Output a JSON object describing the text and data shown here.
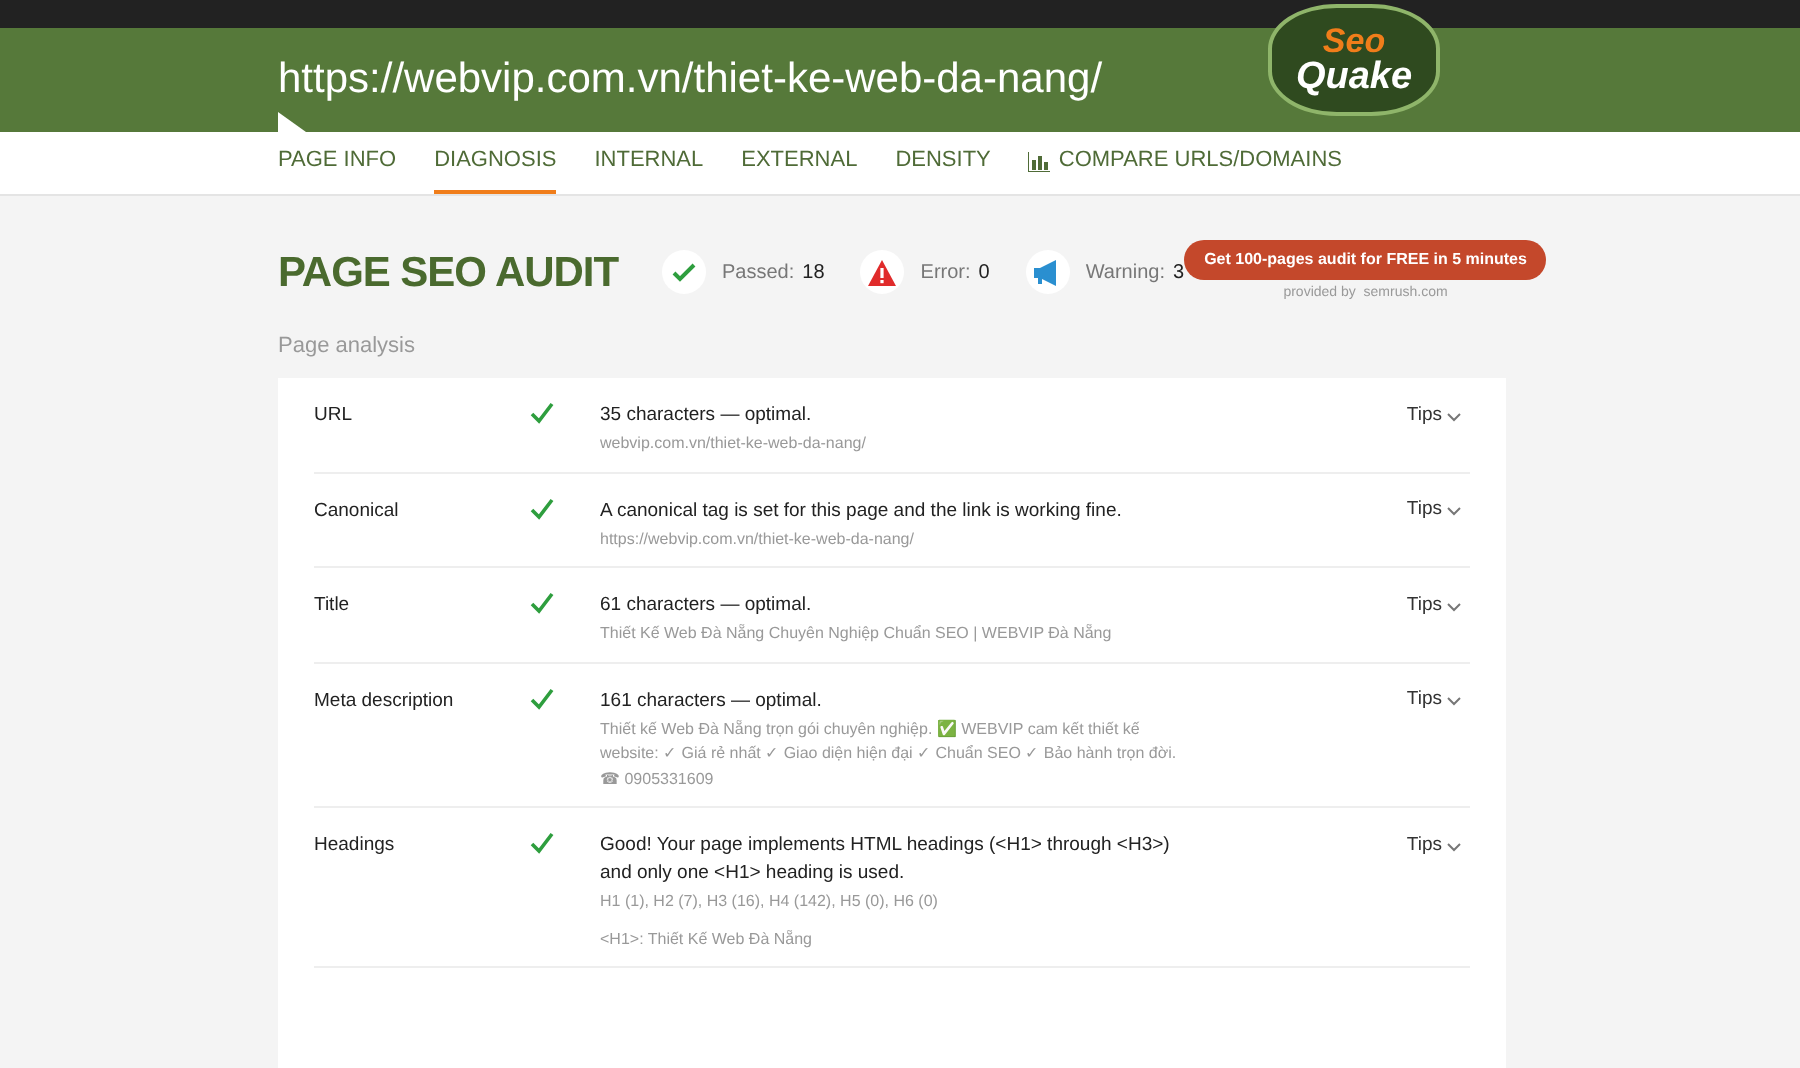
{
  "header": {
    "url": "https://webvip.com.vn/thiet-ke-web-da-nang/",
    "logo_top": "Seo",
    "logo_bottom": "Quake"
  },
  "tabs": [
    {
      "label": "PAGE INFO",
      "selected": false,
      "kind": "text"
    },
    {
      "label": "DIAGNOSIS",
      "selected": true,
      "kind": "text"
    },
    {
      "label": "INTERNAL",
      "selected": false,
      "kind": "text"
    },
    {
      "label": "EXTERNAL",
      "selected": false,
      "kind": "text"
    },
    {
      "label": "DENSITY",
      "selected": false,
      "kind": "text"
    },
    {
      "label": "COMPARE URLS/DOMAINS",
      "selected": false,
      "kind": "chart"
    }
  ],
  "audit": {
    "title": "PAGE SEO AUDIT",
    "stats": [
      {
        "kind": "passed",
        "label": "Passed:",
        "value": "18"
      },
      {
        "kind": "error",
        "label": "Error:",
        "value": "0"
      },
      {
        "kind": "warning",
        "label": "Warning:",
        "value": "3"
      }
    ],
    "cta": "Get 100-pages audit for FREE in 5 minutes",
    "provided_by": "provided by  semrush.com"
  },
  "section_title": "Page analysis",
  "rows": [
    {
      "name": "URL",
      "passed": true,
      "message": "35 characters — optimal.",
      "details": [
        "webvip.com.vn/thiet-ke-web-da-nang/"
      ],
      "tips": "Tips"
    },
    {
      "name": "Canonical",
      "passed": true,
      "message": "A canonical tag is set for this page and the link is working fine.",
      "details": [
        "https://webvip.com.vn/thiet-ke-web-da-nang/"
      ],
      "tips": "Tips"
    },
    {
      "name": "Title",
      "passed": true,
      "message": "61 characters — optimal.",
      "details": [
        "Thiết Kế Web Đà Nẵng Chuyên Nghiệp Chuẩn SEO | WEBVIP Đà Nẵng"
      ],
      "tips": "Tips"
    },
    {
      "name": "Meta description",
      "passed": true,
      "message": "161 characters — optimal.",
      "details": [
        "Thiết kế Web Đà Nẵng trọn gói chuyên nghiệp. ✅ WEBVIP cam kết thiết kế website: ✓ Giá rẻ nhất ✓ Giao diện hiện đại ✓ Chuẩn SEO ✓ Bảo hành trọn đời. ☎ 0905331609"
      ],
      "tips": "Tips"
    },
    {
      "name": "Headings",
      "passed": true,
      "message": "Good! Your page implements HTML headings (<H1> through <H3>) and only one <H1> heading is used.",
      "details": [
        "H1 (1), H2 (7), H3 (16), H4 (142), H5 (0), H6 (0)",
        "<H1>: Thiết Kế Web Đà Nẵng"
      ],
      "tips": "Tips"
    }
  ]
}
